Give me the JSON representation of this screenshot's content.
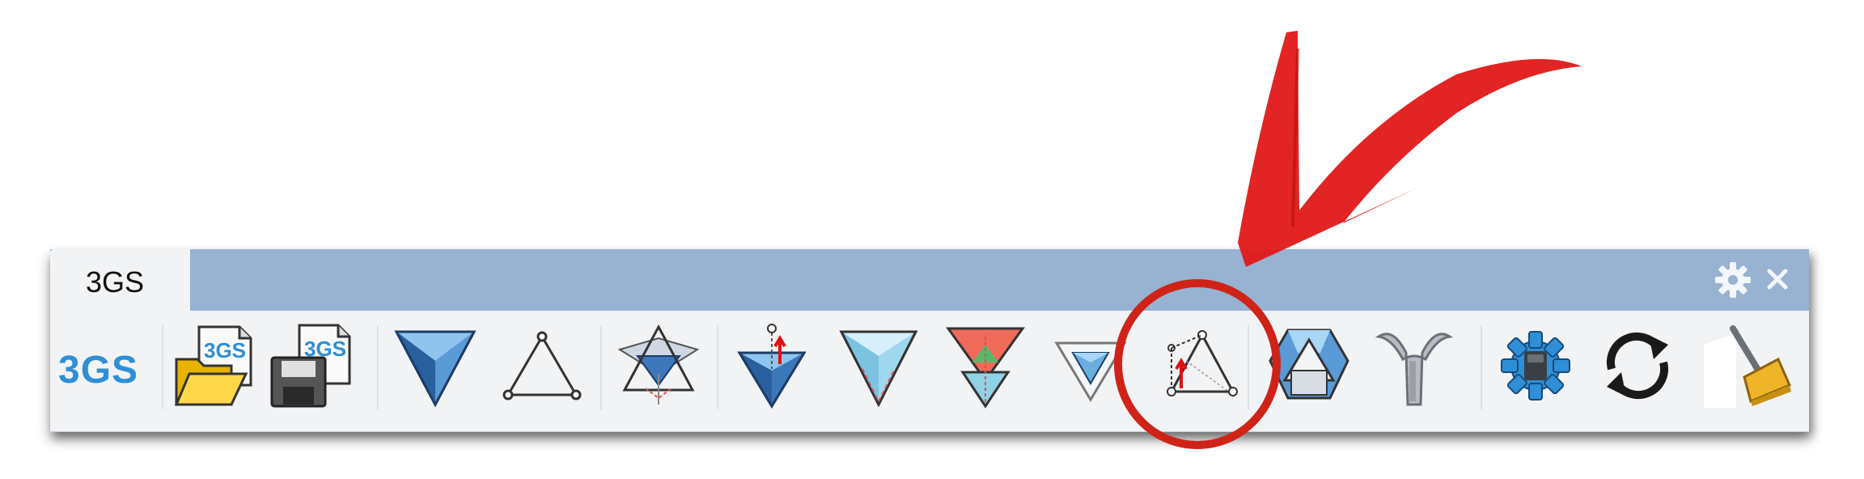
{
  "window": {
    "tab_label": "3GS",
    "logo_text": "3GS",
    "settings_icon": "gear-icon",
    "close_icon": "close-icon"
  },
  "toolbar": {
    "tools": [
      {
        "id": "open-3gs-file",
        "icon": "open-folder-3gs-icon",
        "badge": "3GS"
      },
      {
        "id": "save-3gs-file",
        "icon": "save-floppy-3gs-icon",
        "badge": "3GS"
      },
      {
        "id": "form-diagram",
        "icon": "inverted-pyramid-blue-icon"
      },
      {
        "id": "triangle",
        "icon": "triangle-outline-icon"
      },
      {
        "id": "force-diagram",
        "icon": "star-polyhedron-icon"
      },
      {
        "id": "vertex-move",
        "icon": "pyramid-with-vertex-icon"
      },
      {
        "id": "light-pyramid",
        "icon": "pyramid-light-icon"
      },
      {
        "id": "colored-pyramid",
        "icon": "pyramid-colored-icon"
      },
      {
        "id": "small-pyramid",
        "icon": "pyramid-small-icon"
      },
      {
        "id": "dimension-triangle",
        "icon": "triangle-dimension-icon"
      },
      {
        "id": "solid-box",
        "icon": "solid-box-icon"
      },
      {
        "id": "branch-node",
        "icon": "branch-y-icon"
      },
      {
        "id": "settings-gear",
        "icon": "blue-gear-icon"
      },
      {
        "id": "refresh",
        "icon": "refresh-cycle-icon"
      },
      {
        "id": "clear-brush",
        "icon": "broom-icon"
      }
    ]
  },
  "annotation": {
    "highlight_color": "#d02318",
    "highlighted_tool": "dimension-triangle"
  }
}
